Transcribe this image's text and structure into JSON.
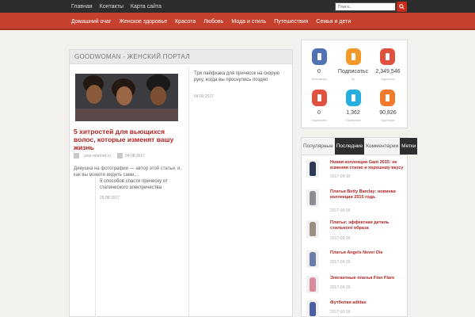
{
  "topnav": {
    "items": [
      "Главная",
      "Контакты",
      "Карта сайта"
    ]
  },
  "search": {
    "placeholder": "Поиск..."
  },
  "mainnav": {
    "items": [
      "Домашний очаг",
      "Женское здоровье",
      "Красота",
      "Любовь",
      "Мода и стиль",
      "Путешествия",
      "Семья и дети"
    ]
  },
  "content": {
    "heading": "GOODWOMAN - ЖЕНСКИЙ ПОРТАЛ",
    "featured": {
      "title": "5 хитростей для вьющихся волос, которые изменят вашу жизнь",
      "author": "your-internet.ru",
      "date": "04.08.2017",
      "excerpt": "Девушка на фотографии — автор этой статьи, и, как вы можете видеть сами,..."
    },
    "side_item": {
      "title": "Три лайфхака для причесок на скорую руку, когда вы проснулись поздно",
      "date": "04.09.2017"
    },
    "bottom_item": {
      "title": "5 способов спасти прическу от статического электричества",
      "date": "29.08.2017"
    }
  },
  "social": {
    "items": [
      {
        "icon": "vk-icon",
        "count": "0",
        "label": "Фолловеры",
        "color": "#4f73b3"
      },
      {
        "icon": "ok-icon",
        "count": "Подписатьс",
        "label": "Тут",
        "color": "#f39a2b"
      },
      {
        "icon": "youtube-icon",
        "count": "2,349,546",
        "label": "Аудитория",
        "color": "#e0513f"
      },
      {
        "icon": "google-plus-icon",
        "count": "0",
        "label": "Подписчики",
        "color": "#e0513f"
      },
      {
        "icon": "twitter-icon",
        "count": "1,362",
        "label": "Подписчики",
        "color": "#27aee0"
      },
      {
        "icon": "rss-icon",
        "count": "90,826",
        "label": "Аудитория",
        "color": "#f07a2b"
      }
    ]
  },
  "tabs": {
    "items": [
      "Популярные",
      "Последние",
      "Комментарии",
      "Метки"
    ],
    "active_index": 1,
    "posts": [
      {
        "title": "Новая коллекция Gant 2015: не изменяя стилю и хорошему вкусу",
        "date": "2017-09-18",
        "dress_color": "#2e3a55"
      },
      {
        "title": "Платья Betty Barclay: новинки коллекции 2015 года.",
        "date": "2017-09-18",
        "dress_color": "#8d8f95"
      },
      {
        "title": "Платье: эффектная деталь стильного образа",
        "date": "2017-09-18",
        "dress_color": "#9a8f80"
      },
      {
        "title": "Платья Angels Never Die",
        "date": "2017-09-18",
        "dress_color": "#6b7ca8"
      },
      {
        "title": "Элегантные платья Finn Flare",
        "date": "2017-09-18",
        "dress_color": "#d98b9c"
      },
      {
        "title": "Футболки adidas",
        "date": "2017-09-18",
        "dress_color": "#4a5fa6"
      }
    ]
  }
}
